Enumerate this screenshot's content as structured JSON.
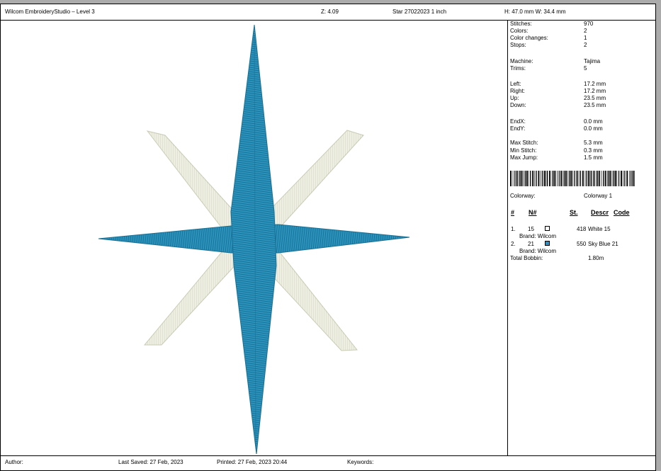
{
  "header": {
    "app_title": "Wilcom EmbroideryStudio – Level 3",
    "zoom": "Z: 4.09",
    "design_name": "Star 27022023 1 inch",
    "dimensions": "H: 47.0 mm   W: 34.4 mm"
  },
  "stats": [
    {
      "label": "Stitches:",
      "value": "970"
    },
    {
      "label": "Colors:",
      "value": "2"
    },
    {
      "label": "Color changes:",
      "value": "1"
    },
    {
      "label": "Stops:",
      "value": "2"
    },
    {
      "label": "Machine:",
      "value": "Tajima"
    },
    {
      "label": "Trims:",
      "value": "5"
    },
    {
      "label": "Left:",
      "value": "17.2 mm"
    },
    {
      "label": "Right:",
      "value": "17.2 mm"
    },
    {
      "label": "Up:",
      "value": "23.5 mm"
    },
    {
      "label": "Down:",
      "value": "23.5 mm"
    },
    {
      "label": "EndX:",
      "value": "0.0 mm"
    },
    {
      "label": "EndY:",
      "value": "0.0 mm"
    },
    {
      "label": "Max Stitch:",
      "value": "5.3 mm"
    },
    {
      "label": "Min Stitch:",
      "value": "0.3 mm"
    },
    {
      "label": "Max Jump:",
      "value": "1.5 mm"
    }
  ],
  "colorway": {
    "label": "Colorway:",
    "value": "Colorway 1"
  },
  "table": {
    "headers": {
      "num": "#",
      "needle": "N#",
      "stitches": "St.",
      "descr": "Descr",
      "code": "Code"
    },
    "rows": [
      {
        "num": "1.",
        "needle": "15",
        "swatch_color": "#ffffff",
        "stitches": "418",
        "name": "White 15",
        "brand": "Brand: Wilcom"
      },
      {
        "num": "2.",
        "needle": "21",
        "swatch_color": "#2f8fc0",
        "stitches": "550",
        "name": "Sky Blue 21",
        "brand": "Brand: Wilcom"
      }
    ],
    "bobbin_label": "Total Bobbin:",
    "bobbin_value": "1.80m"
  },
  "footer": {
    "author": "Author:",
    "last_saved": "Last Saved: 27 Feb, 2023",
    "printed": "Printed: 27 Feb, 2023 20:44",
    "keywords": "Keywords:"
  },
  "colors": {
    "thread_white": "#eeefe2",
    "thread_blue": "#2b93bc"
  }
}
